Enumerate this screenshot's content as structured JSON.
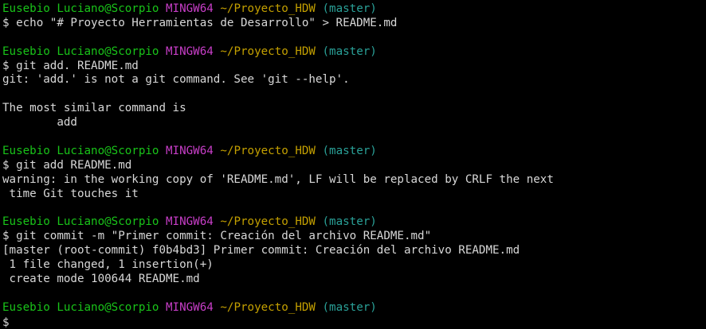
{
  "terminal": {
    "lines": [
      {
        "type": "prompt",
        "user": "Eusebio Luciano@Scorpio",
        "system": "MINGW64",
        "path": "~/Proyecto_HDW",
        "branch": "(master)"
      },
      {
        "type": "text",
        "text": "$ echo \"# Proyecto Herramientas de Desarrollo\" > README.md"
      },
      {
        "type": "text",
        "text": ""
      },
      {
        "type": "prompt",
        "user": "Eusebio Luciano@Scorpio",
        "system": "MINGW64",
        "path": "~/Proyecto_HDW",
        "branch": "(master)"
      },
      {
        "type": "text",
        "text": "$ git add. README.md"
      },
      {
        "type": "text",
        "text": "git: 'add.' is not a git command. See 'git --help'."
      },
      {
        "type": "text",
        "text": ""
      },
      {
        "type": "text",
        "text": "The most similar command is"
      },
      {
        "type": "text",
        "text": "        add"
      },
      {
        "type": "text",
        "text": ""
      },
      {
        "type": "prompt",
        "user": "Eusebio Luciano@Scorpio",
        "system": "MINGW64",
        "path": "~/Proyecto_HDW",
        "branch": "(master)"
      },
      {
        "type": "text",
        "text": "$ git add README.md"
      },
      {
        "type": "text",
        "text": "warning: in the working copy of 'README.md', LF will be replaced by CRLF the next"
      },
      {
        "type": "text",
        "text": " time Git touches it"
      },
      {
        "type": "text",
        "text": ""
      },
      {
        "type": "prompt",
        "user": "Eusebio Luciano@Scorpio",
        "system": "MINGW64",
        "path": "~/Proyecto_HDW",
        "branch": "(master)"
      },
      {
        "type": "text",
        "text": "$ git commit -m \"Primer commit: Creación del archivo README.md\""
      },
      {
        "type": "text",
        "text": "[master (root-commit) f0b4bd3] Primer commit: Creación del archivo README.md"
      },
      {
        "type": "text",
        "text": " 1 file changed, 1 insertion(+)"
      },
      {
        "type": "text",
        "text": " create mode 100644 README.md"
      },
      {
        "type": "text",
        "text": ""
      },
      {
        "type": "prompt",
        "user": "Eusebio Luciano@Scorpio",
        "system": "MINGW64",
        "path": "~/Proyecto_HDW",
        "branch": "(master)"
      },
      {
        "type": "input",
        "text": "$"
      }
    ]
  },
  "colors": {
    "background": "#000000",
    "text": "#d8d8d8",
    "user": "#19c419",
    "system": "#c83ec8",
    "path": "#c4a000",
    "branch": "#2aa198"
  }
}
